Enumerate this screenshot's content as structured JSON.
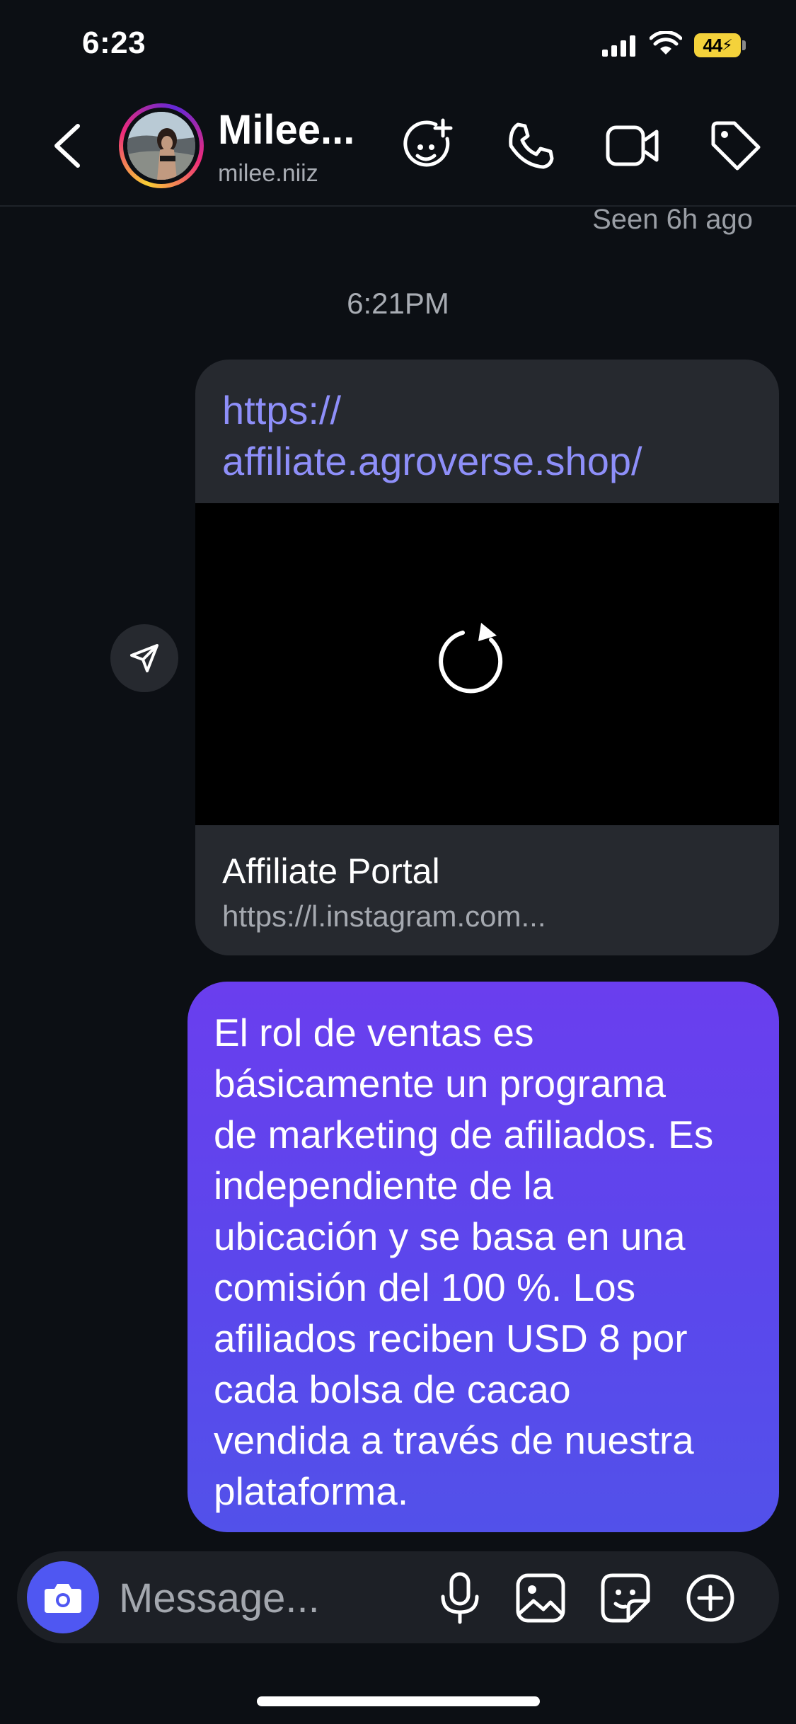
{
  "status_bar": {
    "time": "6:23",
    "battery": "44"
  },
  "header": {
    "contact_name": "Milee...",
    "contact_handle": "milee.niiz",
    "icons": [
      "back-icon",
      "avatar",
      "add-effect-icon",
      "phone-icon",
      "video-icon",
      "tag-icon"
    ]
  },
  "messages": {
    "seen_status": "Seen 6h ago",
    "timestamp": "6:21PM",
    "link": {
      "url": "https://\naffiliate.agroverse.shop/",
      "preview_title": "Affiliate Portal",
      "preview_subtitle": "https://l.instagram.com..."
    },
    "outgoing_text": "El rol de ventas es\nbásicamente un programa\nde marketing de afiliados. Es\nindependiente de la\nubicación y se basa en una\ncomisión del 100 %. Los\nafiliados reciben USD 8 por\ncada bolsa de cacao\nvendida a través de nuestra\nplataforma."
  },
  "composer": {
    "placeholder": "Message..."
  },
  "colors": {
    "background": "#0c0f14",
    "bubble_start": "#6a3eee",
    "bubble_end": "#5251ea",
    "link_text": "#8e8ff9",
    "camera_button": "#4f57f2"
  }
}
